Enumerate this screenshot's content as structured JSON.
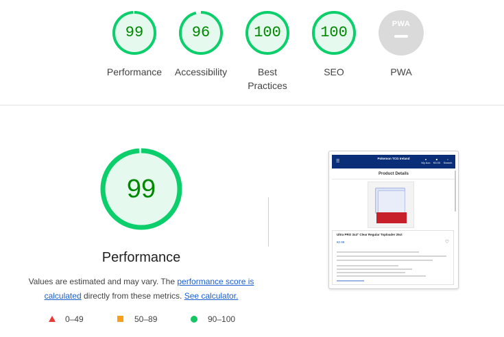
{
  "scores": [
    {
      "label": "Performance",
      "score": "99",
      "value": 99
    },
    {
      "label": "Accessibility",
      "score": "96",
      "value": 96
    },
    {
      "label": "Best Practices",
      "score": "100",
      "value": 100
    },
    {
      "label": "SEO",
      "score": "100",
      "value": 100
    }
  ],
  "pwa": {
    "label": "PWA",
    "badge_text": "PWA"
  },
  "main": {
    "score": "99",
    "value": 99,
    "title": "Performance",
    "desc_prefix": "Values are estimated and may vary. The ",
    "desc_link1": "performance score is calculated",
    "desc_middle": " directly from these metrics. ",
    "desc_link2": "See calculator."
  },
  "legend": [
    {
      "range": "0–49",
      "shape": "triangle-icon",
      "color": "#e93a3a"
    },
    {
      "range": "50–89",
      "shape": "square-icon",
      "color": "#fa9f1a"
    },
    {
      "range": "90–100",
      "shape": "circle-icon",
      "color": "#15c463"
    }
  ],
  "thumbnail": {
    "site_title": "Pokemon TCG Ireland",
    "page_title": "Product Details",
    "product_name": "Ultra PRO 3x4\" Clear Regular Toploader 25ct",
    "price": "€2.99",
    "icons": {
      "account": "My Acc",
      "cart": "€0.00",
      "search": "Search"
    }
  },
  "colors": {
    "pass": "#0cce6b",
    "pass_bg": "#e5f9ee",
    "pass_text": "#008800",
    "link": "#1a5fd0",
    "pwa_grey": "#dadada"
  }
}
